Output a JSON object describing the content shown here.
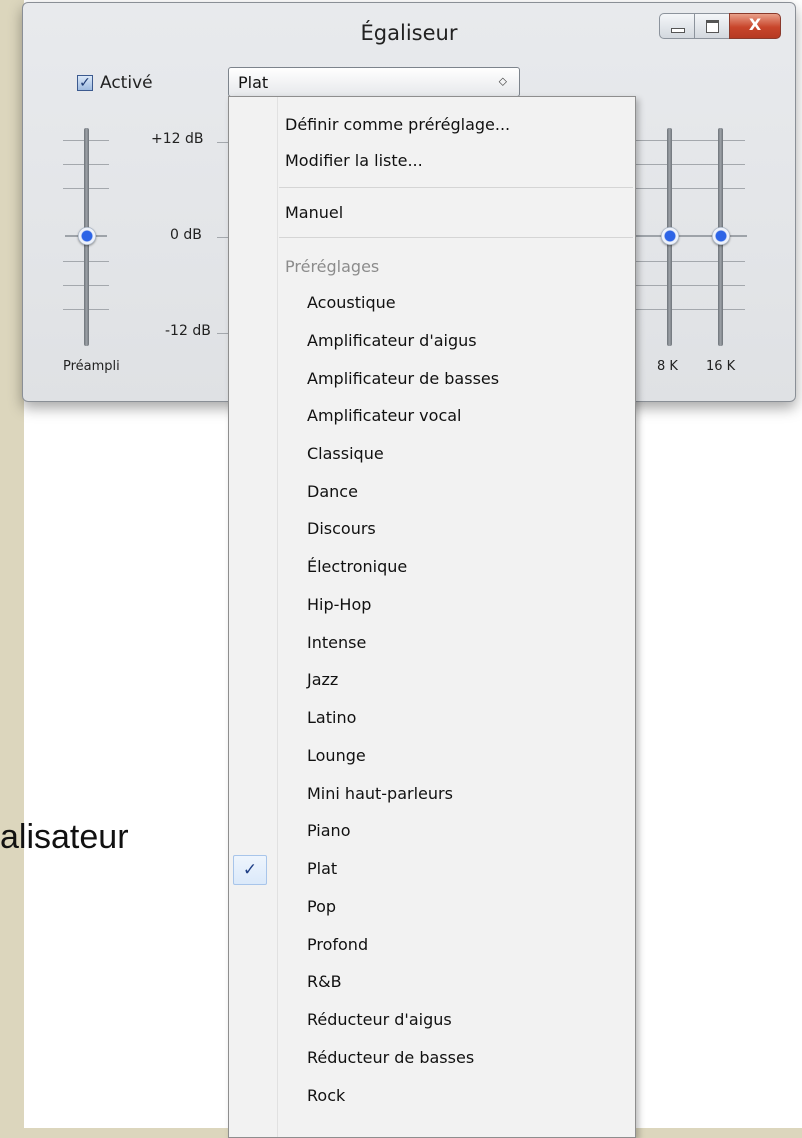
{
  "background_text": "alisateur",
  "window": {
    "title": "Égaliseur",
    "controls": {
      "minimize": "minimize",
      "maximize": "maximize",
      "close": "X"
    }
  },
  "enabled": {
    "label": "Activé",
    "checked": true
  },
  "preset_select": {
    "value": "Plat"
  },
  "scale": {
    "top": "+12 dB",
    "mid": "0 dB",
    "bottom": "-12 dB"
  },
  "bands": {
    "preamp": "Préampli",
    "b8k": "8 K",
    "b16k": "16 K"
  },
  "band_levels_db": {
    "preamp": 0,
    "b8k": 0,
    "b16k": 0
  },
  "menu": {
    "actions": [
      "Définir comme préréglage...",
      "Modifier la liste..."
    ],
    "manual": "Manuel",
    "presets_header": "Préréglages",
    "presets": [
      "Acoustique",
      "Amplificateur d'aigus",
      "Amplificateur de basses",
      "Amplificateur vocal",
      "Classique",
      "Dance",
      "Discours",
      "Électronique",
      "Hip-Hop",
      "Intense",
      "Jazz",
      "Latino",
      "Lounge",
      "Mini haut-parleurs",
      "Piano",
      "Plat",
      "Pop",
      "Profond",
      "R&B",
      "Réducteur d'aigus",
      "Réducteur de basses",
      "Rock"
    ],
    "selected_preset": "Plat",
    "check_glyph": "✓"
  }
}
